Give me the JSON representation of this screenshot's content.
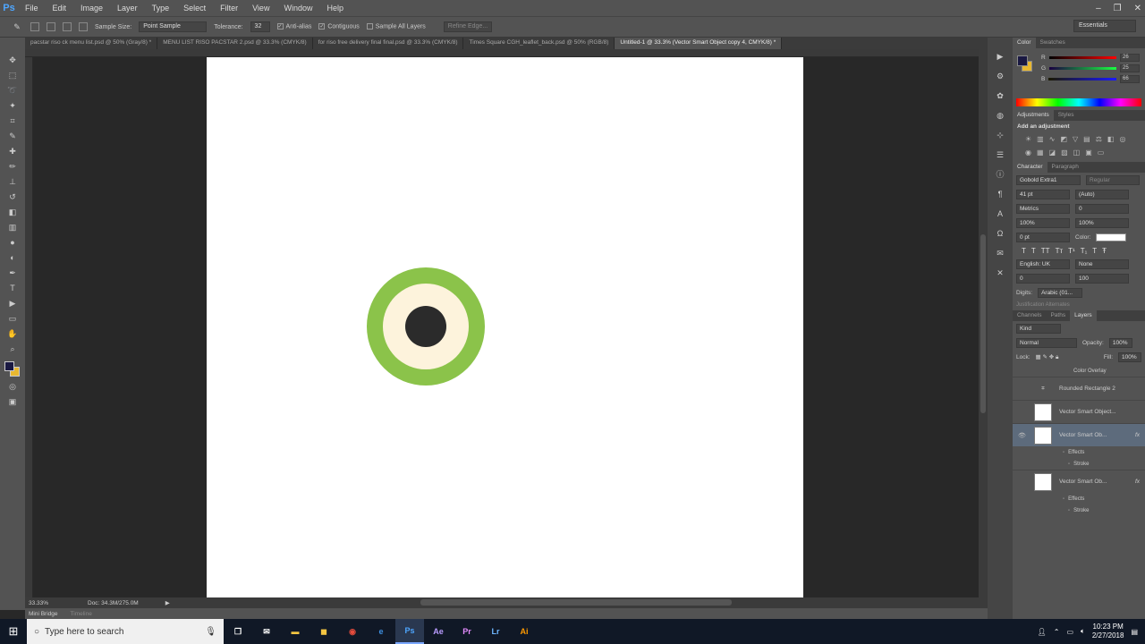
{
  "app": {
    "logo": "Ps",
    "menu": [
      "File",
      "Edit",
      "Image",
      "Layer",
      "Type",
      "Select",
      "Filter",
      "View",
      "Window",
      "Help"
    ],
    "window_controls": [
      "–",
      "❐",
      "✕"
    ]
  },
  "options": {
    "sample_size_label": "Sample Size:",
    "sample_size_value": "Point Sample",
    "tolerance_label": "Tolerance:",
    "tolerance_value": "32",
    "anti_alias": "Anti-alias",
    "contiguous": "Contiguous",
    "sample_all_layers": "Sample All Layers",
    "refine_edge": "Refine Edge...",
    "workspace": "Essentials"
  },
  "tabs": [
    "pacstar riso ck menu list.psd @ 50% (Gray/8) *",
    "MENU LIST RISO PACSTAR 2.psd @ 33.3% (CMYK/8)",
    "for riso free delivery final final.psd @ 33.3% (CMYK/8)",
    "Times Square CGH_leaflet_back.psd @ 50% (RGB/8)",
    "Untitled-1 @ 33.3% (Vector Smart Object copy 4, CMYK/8) *"
  ],
  "status": {
    "zoom": "33.33%",
    "doc": "Doc: 34.3M/275.0M"
  },
  "bottom_tabs": [
    "Mini Bridge",
    "Timeline"
  ],
  "color_panel": {
    "tabs": [
      "Color",
      "Swatches"
    ],
    "r": "26",
    "g": "25",
    "b": "66",
    "fg": "#1a1942",
    "bg": "#e8b830"
  },
  "adjustments": {
    "tabs": [
      "Adjustments",
      "Styles"
    ],
    "heading": "Add an adjustment"
  },
  "character": {
    "tabs": [
      "Character",
      "Paragraph"
    ],
    "font": "Gobold Extra1",
    "style": "Regular",
    "size": "41 pt",
    "leading": "(Auto)",
    "kerning": "Metrics",
    "tracking": "0",
    "vscale": "100%",
    "hscale": "100%",
    "baseline": "0 pt",
    "color_label": "Color:",
    "language": "English: UK",
    "aa": "None",
    "indent1": "0",
    "indent2": "100",
    "digits_label": "Digits:",
    "digits": "Arabic (01...",
    "justification": "Justification Alternates"
  },
  "layers_panel": {
    "tabs": [
      "Channels",
      "Paths",
      "Layers"
    ],
    "kind": "Kind",
    "blend": "Normal",
    "opacity_label": "Opacity:",
    "opacity": "100%",
    "lock_label": "Lock:",
    "fill_label": "Fill:",
    "fill": "100%",
    "color_overlay": "Color Overlay",
    "layers": [
      "Rounded Rectangle 2",
      "Vector Smart Object...",
      "Vector Smart Ob...",
      "Vector Smart Ob..."
    ],
    "effects": "Effects",
    "stroke": "Stroke"
  },
  "taskbar": {
    "search_placeholder": "Type here to search",
    "apps": [
      "Ps",
      "Ae",
      "Pr",
      "Lr",
      "Ai"
    ],
    "time": "10:23 PM",
    "date": "2/27/2018"
  }
}
